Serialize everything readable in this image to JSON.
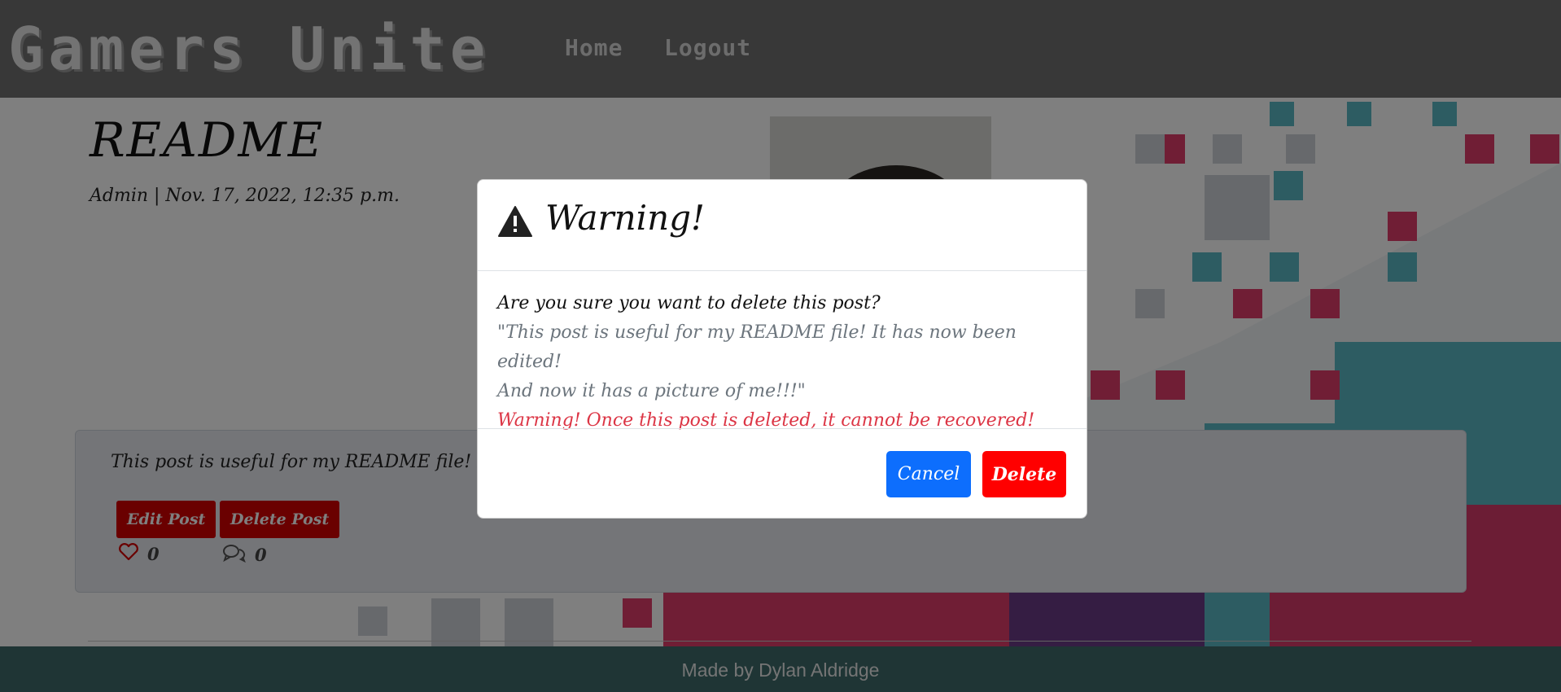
{
  "navbar": {
    "brand": "Gamers Unite",
    "links": [
      "Home",
      "Logout"
    ]
  },
  "post": {
    "title": "README",
    "meta": "Admin | Nov. 17, 2022, 12:35 p.m.",
    "excerpt": "This post is useful for my README file! It",
    "edit_label": "Edit Post",
    "delete_label": "Delete Post",
    "likes": "0",
    "comments": "0"
  },
  "modal": {
    "title": "Warning!",
    "question": "Are you sure you want to delete this post?",
    "quote_line1": "\"This post is useful for my README file! It has now been edited!",
    "quote_line2": "And now it has a picture of me!!!\"",
    "danger": "Warning! Once this post is deleted, it cannot be recovered!",
    "cancel_label": "Cancel",
    "delete_label": "Delete"
  },
  "footer": {
    "text": "Made by Dylan Aldridge"
  },
  "colors": {
    "primary": "#0d6efd",
    "delete": "#ff0000",
    "danger_text": "#dc3545",
    "post_button": "#d40000",
    "backdrop": "rgba(0,0,0,0.5)"
  }
}
